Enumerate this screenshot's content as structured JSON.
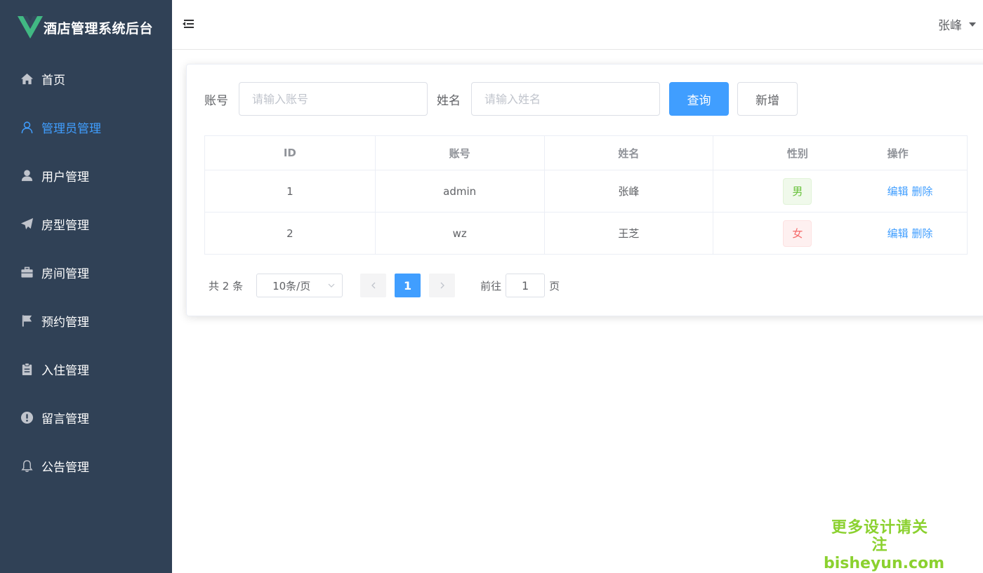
{
  "app": {
    "title": "酒店管理系统后台"
  },
  "sidebar": {
    "items": [
      {
        "label": "首页",
        "icon": "home-icon",
        "active": false
      },
      {
        "label": "管理员管理",
        "icon": "user-outline-icon",
        "active": true
      },
      {
        "label": "用户管理",
        "icon": "user-solid-icon",
        "active": false
      },
      {
        "label": "房型管理",
        "icon": "paper-plane-icon",
        "active": false
      },
      {
        "label": "房间管理",
        "icon": "suitcase-icon",
        "active": false
      },
      {
        "label": "预约管理",
        "icon": "flag-icon",
        "active": false
      },
      {
        "label": "入住管理",
        "icon": "clipboard-icon",
        "active": false
      },
      {
        "label": "留言管理",
        "icon": "warning-icon",
        "active": false
      },
      {
        "label": "公告管理",
        "icon": "bell-icon",
        "active": false
      }
    ]
  },
  "header": {
    "user_name": "张峰"
  },
  "search": {
    "account_label": "账号",
    "account_placeholder": "请输入账号",
    "name_label": "姓名",
    "name_placeholder": "请输入姓名",
    "query_button": "查询",
    "add_button": "新增"
  },
  "table": {
    "columns": [
      "ID",
      "账号",
      "姓名",
      "性别",
      "操作"
    ],
    "rows": [
      {
        "id": "1",
        "account": "admin",
        "name": "张峰",
        "gender": "男",
        "edit": "编辑",
        "delete": "删除"
      },
      {
        "id": "2",
        "account": "wz",
        "name": "王芝",
        "gender": "女",
        "edit": "编辑",
        "delete": "删除"
      }
    ]
  },
  "pagination": {
    "total_text": "共 2 条",
    "page_size": "10条/页",
    "current_page": "1",
    "goto_label": "前往",
    "goto_value": "1",
    "page_suffix": "页"
  },
  "watermark": {
    "line1": "更多设计请关注",
    "line2": "bisheyun.com"
  },
  "colors": {
    "sidebar_bg": "#304156",
    "accent": "#409eff",
    "logo_green": "#41b883"
  }
}
